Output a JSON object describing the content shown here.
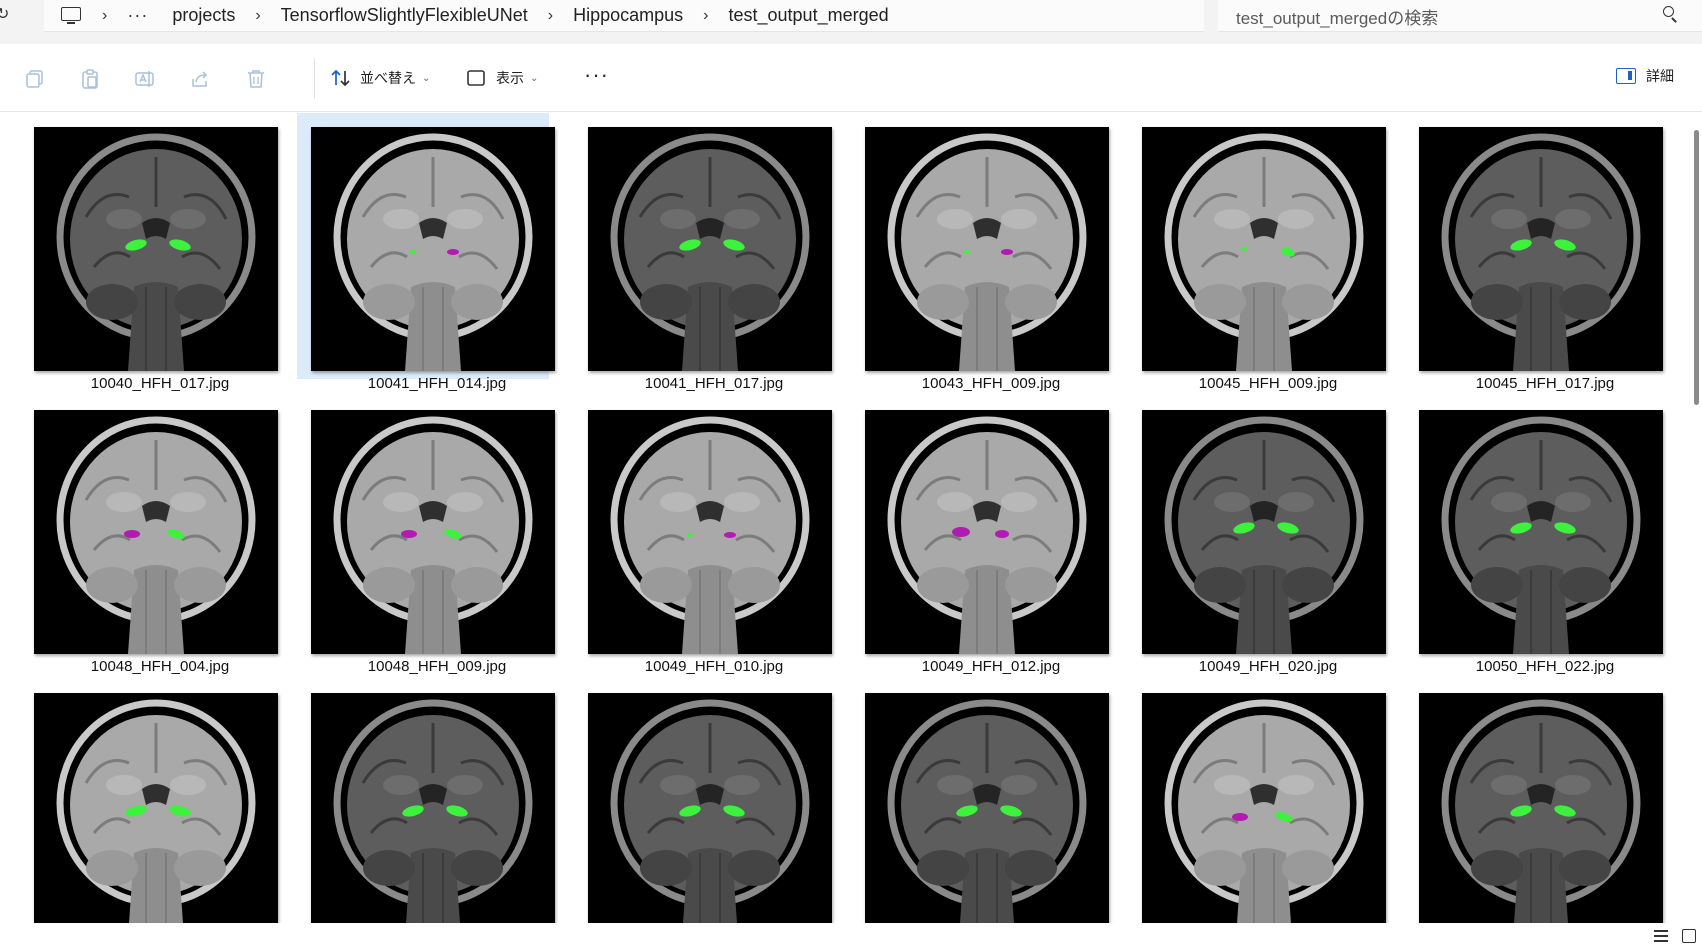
{
  "address_bar": {
    "refresh_glyph": "↻",
    "more_glyph": "···",
    "breadcrumbs": [
      "projects",
      "TensorflowSlightlyFlexibleUNet",
      "Hippocampus",
      "test_output_merged"
    ],
    "chevron": "›"
  },
  "search": {
    "placeholder": "test_output_mergedの検索"
  },
  "command_bar": {
    "disabled_icons": [
      "copy-icon",
      "paste-icon",
      "rename-icon",
      "share-icon",
      "delete-icon"
    ],
    "sort_label": "並べ替え",
    "view_label": "表示",
    "more_label": "···",
    "details_label": "詳細"
  },
  "files": [
    {
      "name": "10040_HFH_017.jpg",
      "brightness": "dark",
      "marks": "green",
      "selected": false
    },
    {
      "name": "10041_HFH_014.jpg",
      "brightness": "light",
      "marks": "magenta-small",
      "selected": true
    },
    {
      "name": "10041_HFH_017.jpg",
      "brightness": "dark",
      "marks": "green",
      "selected": false
    },
    {
      "name": "10043_HFH_009.jpg",
      "brightness": "light",
      "marks": "magenta-small",
      "selected": false
    },
    {
      "name": "10045_HFH_009.jpg",
      "brightness": "light",
      "marks": "green-small",
      "selected": false
    },
    {
      "name": "10045_HFH_017.jpg",
      "brightness": "dark",
      "marks": "green",
      "selected": false
    },
    {
      "name": "10048_HFH_004.jpg",
      "brightness": "light",
      "marks": "mixed",
      "selected": false
    },
    {
      "name": "10048_HFH_009.jpg",
      "brightness": "light",
      "marks": "mixed",
      "selected": false
    },
    {
      "name": "10049_HFH_010.jpg",
      "brightness": "light",
      "marks": "magenta-small",
      "selected": false
    },
    {
      "name": "10049_HFH_012.jpg",
      "brightness": "light",
      "marks": "magenta",
      "selected": false
    },
    {
      "name": "10049_HFH_020.jpg",
      "brightness": "dark",
      "marks": "green",
      "selected": false
    },
    {
      "name": "10050_HFH_022.jpg",
      "brightness": "dark",
      "marks": "green",
      "selected": false
    },
    {
      "name": "",
      "brightness": "light",
      "marks": "green",
      "selected": false
    },
    {
      "name": "",
      "brightness": "dark",
      "marks": "green",
      "selected": false
    },
    {
      "name": "",
      "brightness": "dark",
      "marks": "green",
      "selected": false
    },
    {
      "name": "",
      "brightness": "dark",
      "marks": "green",
      "selected": false
    },
    {
      "name": "",
      "brightness": "light",
      "marks": "mixed",
      "selected": false
    },
    {
      "name": "",
      "brightness": "dark",
      "marks": "green",
      "selected": false
    }
  ],
  "colors": {
    "selection": "#dcebfa",
    "mask_green": "#3cf23c",
    "mask_magenta": "#b21ab2",
    "accent": "#1b62c4"
  },
  "status_bar": {
    "icons": [
      "view-list-icon",
      "view-tiles-icon"
    ]
  }
}
